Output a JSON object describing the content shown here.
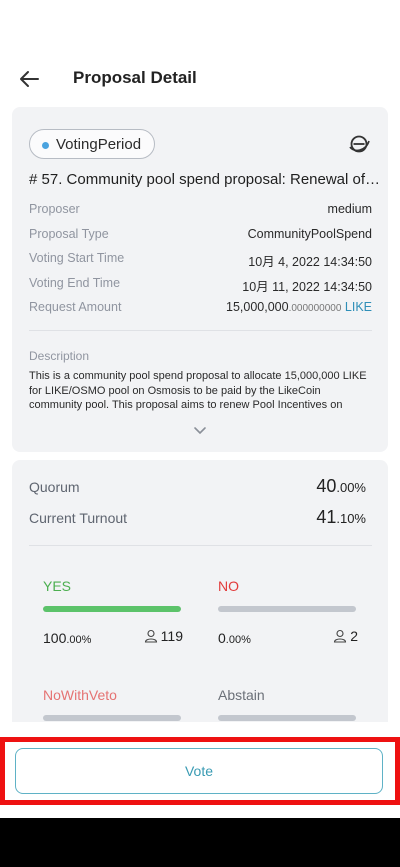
{
  "header": {
    "title": "Proposal Detail",
    "back_icon": "arrow-left-icon"
  },
  "proposal": {
    "status": "VotingPeriod",
    "status_color": "#4aa3df",
    "explorer_icon": "explorer-e-icon",
    "title": "# 57. Community pool spend proposal: Renewal of…",
    "fields": [
      {
        "label": "Proposer",
        "value": "medium"
      },
      {
        "label": "Proposal Type",
        "value": "CommunityPoolSpend"
      },
      {
        "label": "Voting Start Time",
        "value": "10月 4, 2022 14:34:50"
      },
      {
        "label": "Voting End Time",
        "value": "10月 11, 2022 14:34:50"
      }
    ],
    "request_amount": {
      "label": "Request Amount",
      "integer": "15,000,000",
      "decimal": ".000000000",
      "denom": "LIKE"
    },
    "description_label": "Description",
    "description": "This is a community pool spend proposal to allocate 15,000,000 LIKE for LIKE/OSMO pool on Osmosis to be paid by the LikeCoin community pool. This proposal aims to renew Pool Incentives on",
    "expand_icon": "chevron-down-icon"
  },
  "tally": {
    "quorum": {
      "label": "Quorum",
      "value": "40",
      "pct": ".00%"
    },
    "turnout": {
      "label": "Current Turnout",
      "value": "41",
      "pct": ".10%"
    },
    "options": [
      {
        "label": "YES",
        "color": "#4caf50",
        "pct_main": "100",
        "pct_decimal": ".00%",
        "voters": "119",
        "fill_fraction": 1.0
      },
      {
        "label": "NO",
        "color": "#e23b3b",
        "pct_main": "0",
        "pct_decimal": ".00%",
        "voters": "2",
        "fill_fraction": 0.0
      },
      {
        "label": "NoWithVeto",
        "color": "#e57373",
        "fill_fraction": 0.0
      },
      {
        "label": "Abstain",
        "color": "#6b7078",
        "fill_fraction": 0.0
      }
    ],
    "voter_icon": "user-icon"
  },
  "actions": {
    "vote_label": "Vote"
  }
}
